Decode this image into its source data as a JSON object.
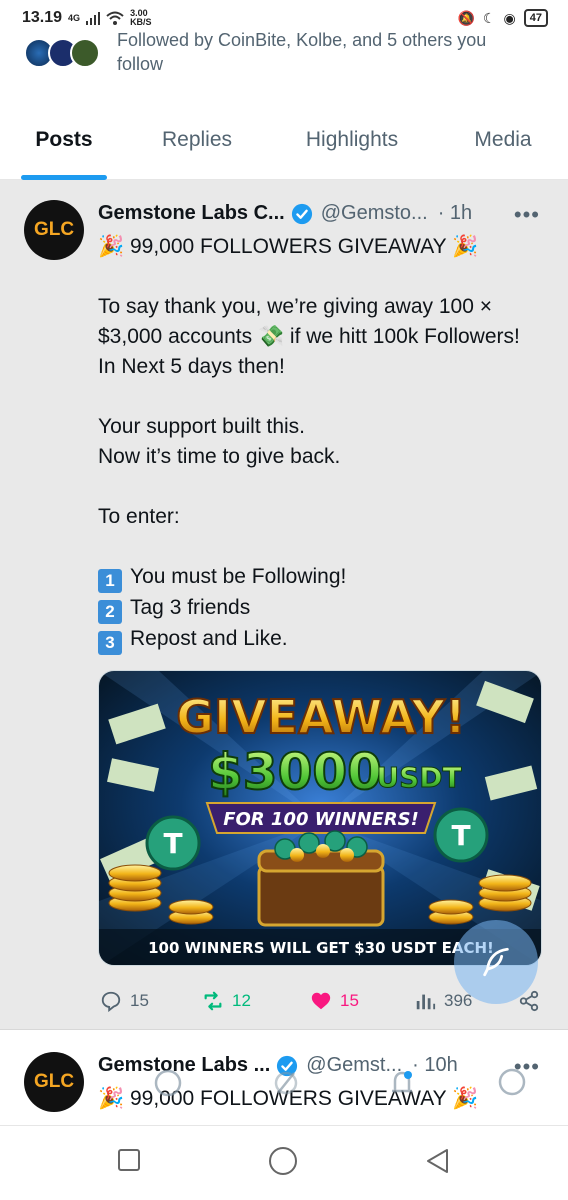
{
  "status_bar": {
    "time": "13.19",
    "network": "4G",
    "speed_value": "3.00",
    "speed_unit": "KB/S",
    "battery": "47"
  },
  "followed_by": {
    "text": "Followed by CoinBite, Kolbe, and 5 others you follow"
  },
  "tabs": [
    {
      "label": "Posts",
      "active": true
    },
    {
      "label": "Replies",
      "active": false
    },
    {
      "label": "Highlights",
      "active": false
    },
    {
      "label": "Media",
      "active": false
    }
  ],
  "posts": [
    {
      "avatar_text": "GLC",
      "name": "Gemstone Labs C...",
      "handle": "@Gemsto...",
      "time": "· 1h",
      "more": "•••",
      "title": "🎉 99,000 FOLLOWERS GIVEAWAY 🎉",
      "lines": [
        "To say thank you, we’re giving away 100 × $3,000 accounts 💸 if we hitt 100k Followers!  In Next 5 days then!",
        "",
        "Your support built this.",
        "Now it’s time to give back.",
        "",
        "To enter:",
        ""
      ],
      "steps": [
        {
          "num": "1",
          "text": "You must be Following!"
        },
        {
          "num": "2",
          "text": "Tag 3 friends"
        },
        {
          "num": "3",
          "text": "Repost and Like."
        }
      ],
      "image": {
        "headline": "GIVEAWAY!",
        "amount": "$3000",
        "currency": "USDT",
        "subline": "FOR 100 WINNERS!",
        "footer": "100 WINNERS WILL GET $30 USDT EACH!"
      },
      "actions": {
        "replies": "15",
        "reposts": "12",
        "likes": "15",
        "views": "396"
      },
      "colors": {
        "repost": "#00ba7c",
        "like": "#f91880",
        "accent": "#1d9bf0"
      }
    },
    {
      "avatar_text": "GLC",
      "name": "Gemstone Labs ...",
      "handle": "@Gemst...",
      "time": "· 10h",
      "more": "•••",
      "title": "🎉 99,000 FOLLOWERS GIVEAWAY 🎉"
    }
  ]
}
